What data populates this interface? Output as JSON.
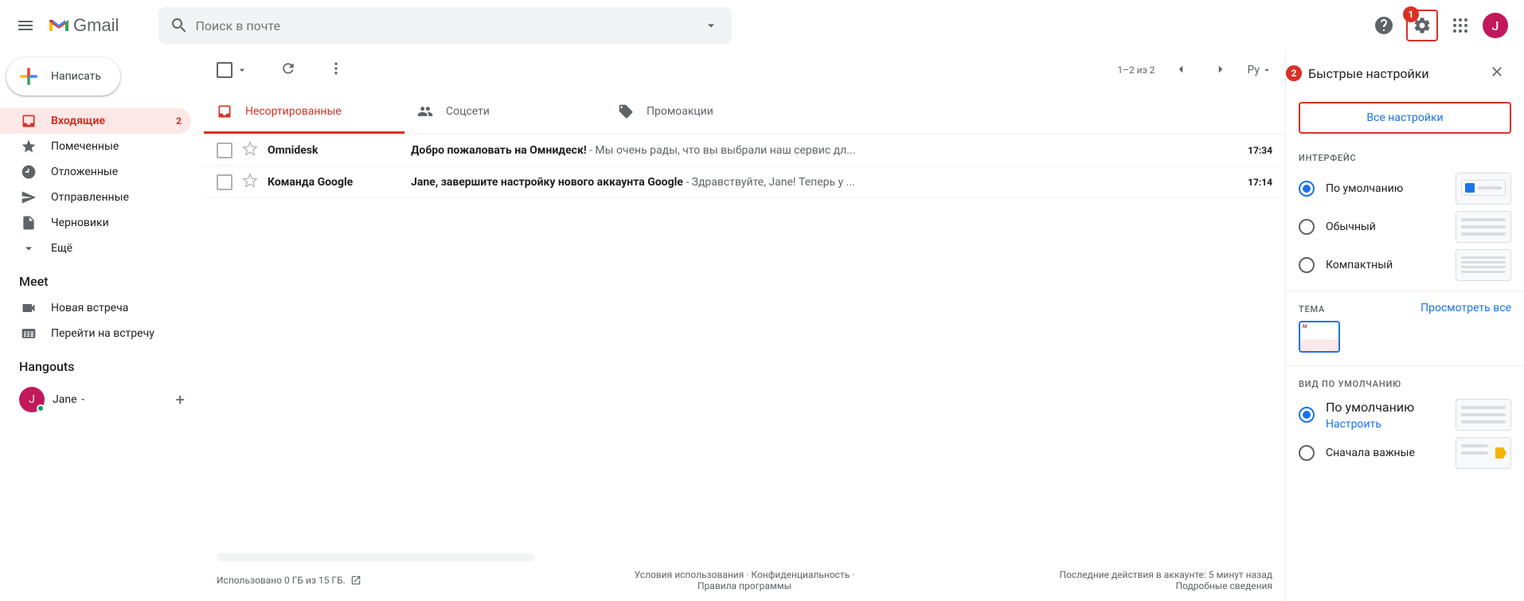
{
  "header": {
    "logo_text": "Gmail",
    "search_placeholder": "Поиск в почте",
    "avatar_initial": "J",
    "badge1": "1"
  },
  "compose_label": "Написать",
  "nav": [
    {
      "label": "Входящие",
      "count": "2",
      "active": true
    },
    {
      "label": "Помеченные"
    },
    {
      "label": "Отложенные"
    },
    {
      "label": "Отправленные"
    },
    {
      "label": "Черновики"
    },
    {
      "label": "Ещё"
    }
  ],
  "meet": {
    "title": "Meet",
    "new": "Новая встреча",
    "join": "Перейти на встречу"
  },
  "hangouts": {
    "title": "Hangouts",
    "user": "Jane",
    "initial": "J"
  },
  "toolbar": {
    "count_text": "1–2 из 2",
    "lang": "Ру"
  },
  "tabs": {
    "primary": "Несортированные",
    "social": "Соцсети",
    "promo": "Промоакции"
  },
  "messages": [
    {
      "sender": "Omnidesk",
      "subject": "Добро пожаловать на Омнидеск!",
      "snippet": " - Мы очень рады, что вы выбрали наш сервис дл...",
      "time": "17:34"
    },
    {
      "sender": "Команда Google",
      "subject": "Jane, завершите настройку нового аккаунта Google",
      "snippet": " - Здравствуйте, Jane! Теперь у ...",
      "time": "17:14"
    }
  ],
  "footer": {
    "storage": "Использовано 0 ГБ из 15 ГБ.",
    "terms": "Условия использования",
    "privacy": "Конфиденциальность",
    "program": "Правила программы",
    "activity": "Последние действия в аккаунте: 5 минут назад",
    "details": "Подробные сведения"
  },
  "settings": {
    "badge2": "2",
    "title": "Быстрые настройки",
    "all_settings": "Все настройки",
    "interface_label": "ИНТЕРФЕЙС",
    "density": [
      {
        "label": "По умолчанию",
        "checked": true
      },
      {
        "label": "Обычный"
      },
      {
        "label": "Компактный"
      }
    ],
    "theme_label": "ТЕМА",
    "theme_view_all": "Просмотреть все",
    "default_view_label": "ВИД ПО УМОЛЧАНИЮ",
    "default_view": [
      {
        "label": "По умолчанию",
        "link": "Настроить",
        "checked": true
      },
      {
        "label": "Сначала важные"
      }
    ]
  }
}
